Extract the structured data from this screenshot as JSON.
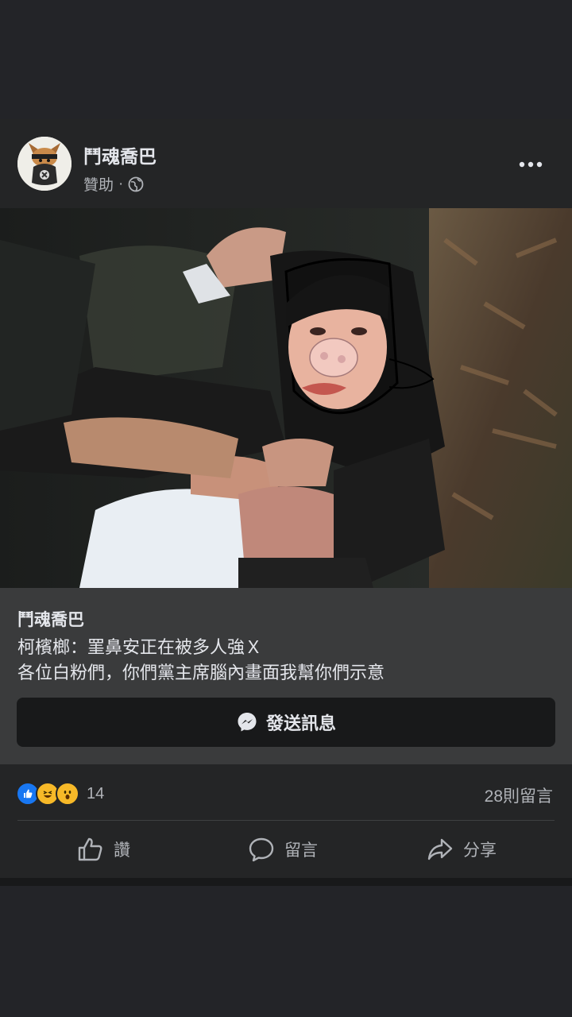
{
  "post": {
    "page_name": "鬥魂喬巴",
    "sponsored_label": "贊助",
    "separator": "·",
    "privacy_icon": "globe-icon",
    "more_icon": "more-horizontal-icon"
  },
  "caption": {
    "title": "鬥魂喬巴",
    "line1": "柯檳榔：罣鼻安正在被多人強Ｘ",
    "line2": "各位白粉們，你們黨主席腦內畫面我幫你們示意"
  },
  "cta": {
    "icon": "messenger-icon",
    "label": "發送訊息"
  },
  "stats": {
    "reaction_icons": [
      "like-icon",
      "haha-icon",
      "wow-icon"
    ],
    "reaction_count": "14",
    "comment_count": "28則留言"
  },
  "actions": [
    {
      "icon": "thumbs-up-icon",
      "label": "讚"
    },
    {
      "icon": "comment-icon",
      "label": "留言"
    },
    {
      "icon": "share-icon",
      "label": "分享"
    }
  ],
  "colors": {
    "background": "#232428",
    "card": "#242526",
    "caption_bg": "#3a3b3c",
    "like_blue": "#1877f2",
    "reaction_yellow": "#f7b928"
  }
}
